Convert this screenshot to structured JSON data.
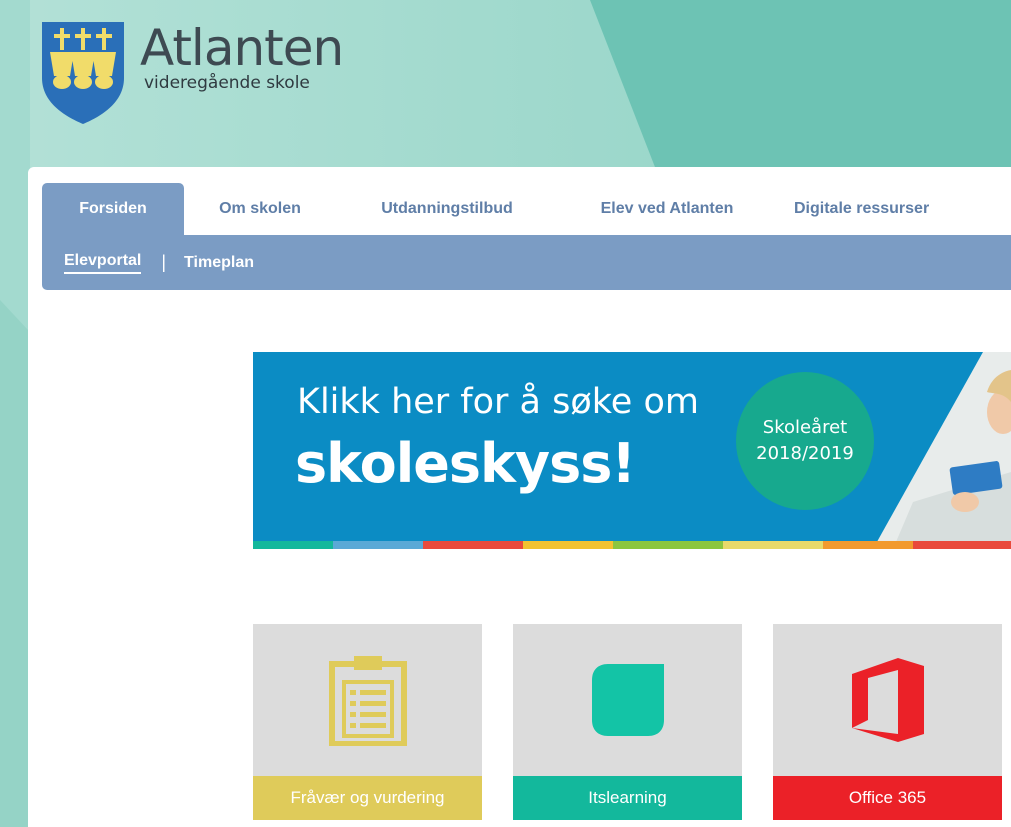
{
  "header": {
    "title": "Atlanten",
    "subtitle": "videregående skole"
  },
  "nav": {
    "tabs": [
      {
        "label": "Forsiden",
        "active": true
      },
      {
        "label": "Om skolen",
        "active": false
      },
      {
        "label": "Utdanningstilbud",
        "active": false
      },
      {
        "label": "Elev ved Atlanten",
        "active": false
      },
      {
        "label": "Digitale ressurser",
        "active": false
      }
    ],
    "subnav": [
      {
        "label": "Elevportal",
        "active": true
      },
      {
        "label": "Timeplan",
        "active": false
      }
    ]
  },
  "banner": {
    "line1": "Klikk her for å søke om",
    "line2": "skoleskyss!",
    "badge_line1": "Skoleåret",
    "badge_line2": "2018/2019"
  },
  "tiles": [
    {
      "label": "Fråvær og vurdering",
      "icon": "clipboard-icon",
      "color": "#dfcb5a"
    },
    {
      "label": "Itslearning",
      "icon": "itslearning-icon",
      "color": "#13b89c"
    },
    {
      "label": "Office 365",
      "icon": "office-icon",
      "color": "#eb2128"
    }
  ],
  "colors": {
    "teal_bg": "#8fd0c3",
    "nav_blue": "#7b9cc4",
    "banner_blue": "#0b8cc4"
  }
}
